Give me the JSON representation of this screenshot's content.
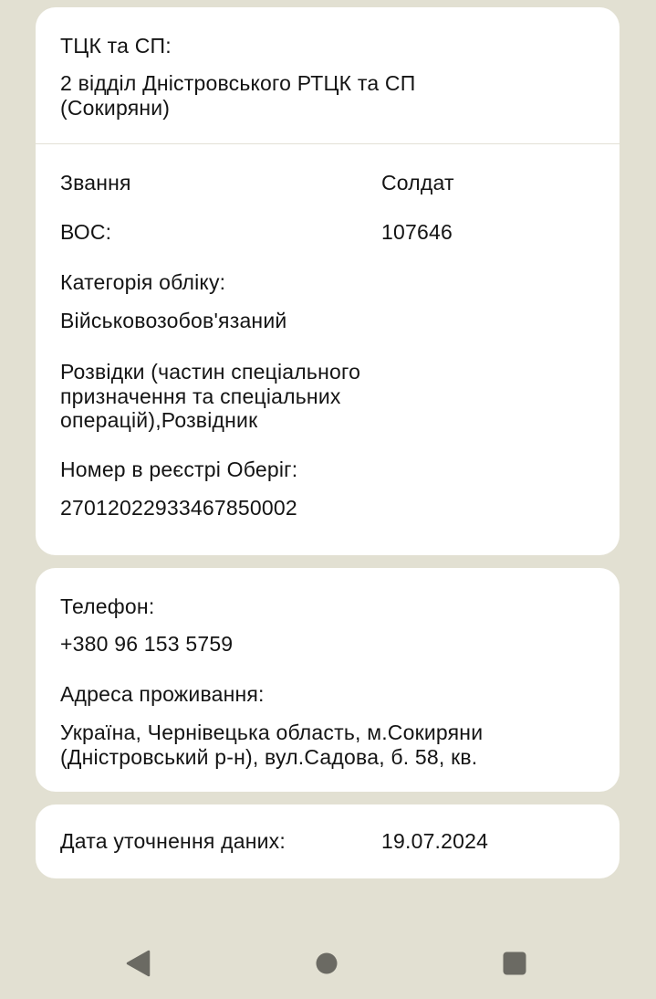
{
  "unit_card": {
    "tck_label": "ТЦК та СП:",
    "tck_value_line1": "2 відділ Дністровського РТЦК та СП",
    "tck_value_line2": "(Сокиряни)",
    "rank_label": "Звання",
    "rank_value": "Солдат",
    "vos_label": "ВОС:",
    "vos_value": "107646",
    "category_label": "Категорія обліку:",
    "category_value": "Військовозобов'язаний",
    "specialty_line1": "Розвідки (частин спеціального",
    "specialty_line2": "призначення та спеціальних",
    "specialty_line3": "операцій),Розвідник",
    "registry_label": "Номер в реєстрі Оберіг:",
    "registry_value": "27012022933467850002"
  },
  "contacts_card": {
    "phone_label": "Телефон:",
    "phone_value": "+380 96 153 5759",
    "address_label": "Адреса проживання:",
    "address_line1": "Україна, Чернівецька область, м.Сокиряни",
    "address_line2": "(Дністровський р-н), вул.Садова, б. 58, кв."
  },
  "date_card": {
    "label": "Дата уточнення даних:",
    "value": "19.07.2024"
  },
  "navbar": {
    "back_icon": "triangle-back-icon",
    "home_icon": "circle-home-icon",
    "recents_icon": "square-recents-icon",
    "icon_color": "#6b6a63"
  },
  "colors": {
    "background": "#e2e0d2",
    "card": "#ffffff",
    "text": "#141414",
    "divider": "#e3e1d6"
  }
}
